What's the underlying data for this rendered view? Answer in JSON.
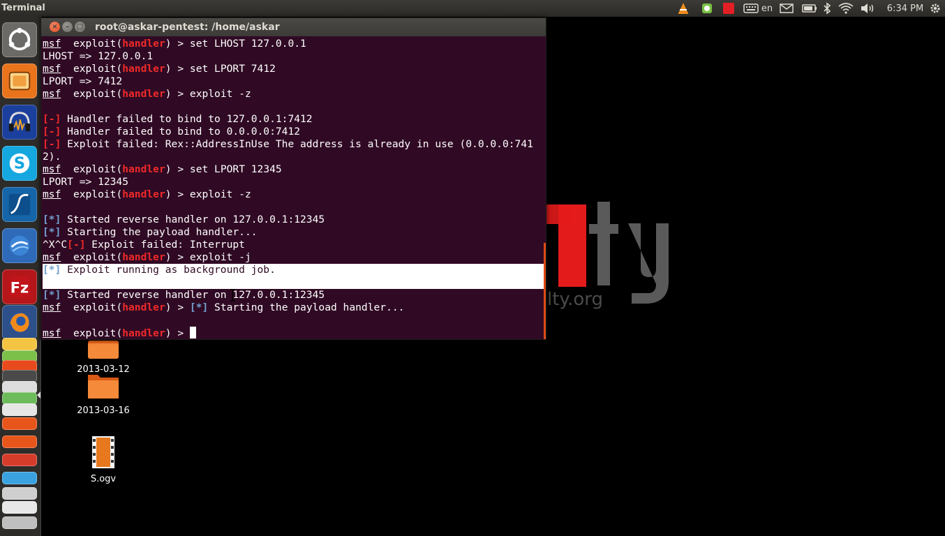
{
  "panel": {
    "app_name": "Terminal",
    "keyboard_layout": "en",
    "clock": "6:34 PM",
    "icons": [
      "vlc-icon",
      "evernote-icon",
      "red-app-icon",
      "keyboard-icon",
      "mail-icon",
      "battery-icon",
      "bluetooth-icon",
      "wifi-icon",
      "volume-icon",
      "settings-gear-icon"
    ]
  },
  "launcher": {
    "items": [
      "dash-home-icon",
      "files-icon",
      "audacity-icon",
      "skype-icon",
      "wireshark-icon",
      "google-earth-icon",
      "filezilla-icon",
      "firefox-icon"
    ],
    "stack": [
      "stack-app-1",
      "stack-app-2",
      "stack-app-3",
      "stack-app-4",
      "stack-app-5",
      "stack-app-6",
      "stack-app-7",
      "stack-app-8",
      "stack-app-9",
      "stack-app-10",
      "stack-app-11"
    ]
  },
  "desktop": {
    "icons": [
      {
        "label": "2013-03-12",
        "type": "folder"
      },
      {
        "label": "2013-03-16",
        "type": "folder"
      },
      {
        "label": "S.ogv",
        "type": "video-file"
      }
    ],
    "wallpaper_text": "lty.org"
  },
  "window": {
    "title": "root@askar-pentest: /home/askar",
    "close_glyph": "×",
    "minimize_glyph": "–",
    "maximize_glyph": "□"
  },
  "terminal": {
    "prompt_msf": "msf",
    "prompt_exploit": "exploit(",
    "prompt_handler": "handler",
    "prompt_end": ") > ",
    "lines": {
      "l1_cmd": "set LHOST 127.0.0.1",
      "l2": "LHOST => 127.0.0.1",
      "l3_cmd": "set LPORT 7412",
      "l4": "LPORT => 7412",
      "l5_cmd": "exploit -z",
      "err_mark": "[-]",
      "l7": " Handler failed to bind to 127.0.0.1:7412",
      "l8": " Handler failed to bind to 0.0.0.0:7412",
      "l9": " Exploit failed: Rex::AddressInUse The address is already in use (0.0.0.0:741",
      "l10": "2).",
      "l11_cmd": "set LPORT 12345",
      "l12": "LPORT => 12345",
      "l13_cmd": "exploit -z",
      "info_mark": "[*]",
      "l15": " Started reverse handler on 127.0.0.1:12345",
      "l16": " Starting the payload handler...",
      "l17_prefix": "^X^C",
      "l17": " Exploit failed: Interrupt",
      "l18_cmd": "exploit -j",
      "l19": " Exploit running as background job.",
      "l21": " Started reverse handler on 127.0.0.1:12345",
      "l22": " Starting the payload handler..."
    }
  }
}
